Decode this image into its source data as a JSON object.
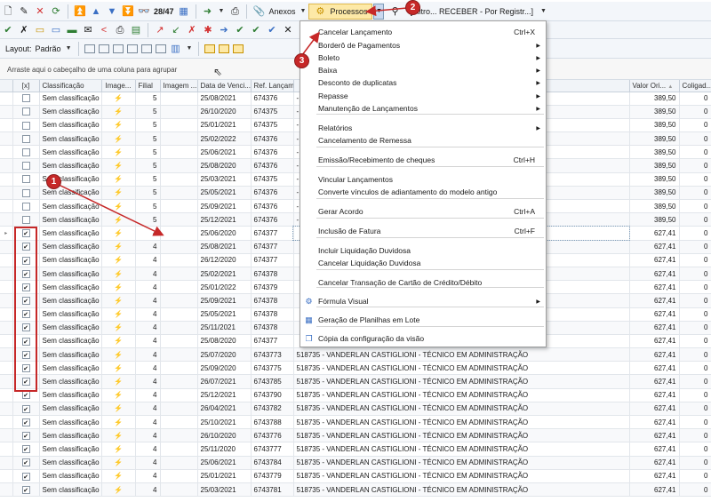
{
  "toolbar1": {
    "counter": "28/47",
    "anexos_label": "Anexos",
    "processos_label": "Processos",
    "filter_text": "[Filtro... RECEBER - Por Registr...]"
  },
  "toolbar3": {
    "layout_label": "Layout:",
    "layout_value": "Padrão"
  },
  "group_panel_text": "Arraste aqui o cabeçalho de uma coluna para agrupar",
  "columns": {
    "check": "[x]",
    "classificacao": "Classificação",
    "imagem": "Image...",
    "filial": "Filial",
    "imagem2": "Imagem ...",
    "data_venc": "Data de Venci...",
    "ref_lanc": "Ref. Lançam...",
    "valor": "Valor Ori...",
    "coligada": "Coligad..."
  },
  "rows": [
    {
      "checked": false,
      "classificacao": "Sem classificação",
      "filial": "5",
      "data": "25/08/2021",
      "ref": "674376",
      "desc": "- A DISTÂNCIA",
      "valor": "389,50",
      "col": "0"
    },
    {
      "checked": false,
      "classificacao": "Sem classificação",
      "filial": "5",
      "data": "26/10/2020",
      "ref": "674375",
      "desc": "- A DISTÂNCIA",
      "valor": "389,50",
      "col": "0"
    },
    {
      "checked": false,
      "classificacao": "Sem classificação",
      "filial": "5",
      "data": "25/01/2021",
      "ref": "674375",
      "desc": "- A DISTÂNCIA",
      "valor": "389,50",
      "col": "0"
    },
    {
      "checked": false,
      "classificacao": "Sem classificação",
      "filial": "5",
      "data": "25/02/2022",
      "ref": "674376",
      "desc": "- A DISTÂNCIA",
      "valor": "389,50",
      "col": "0"
    },
    {
      "checked": false,
      "classificacao": "Sem classificação",
      "filial": "5",
      "data": "25/06/2021",
      "ref": "674376",
      "desc": "- A DISTÂNCIA",
      "valor": "389,50",
      "col": "0"
    },
    {
      "checked": false,
      "classificacao": "Sem classificação",
      "filial": "5",
      "data": "25/08/2020",
      "ref": "674376",
      "desc": "- A DISTÂNCIA",
      "valor": "389,50",
      "col": "0"
    },
    {
      "checked": false,
      "classificacao": "Sem classificação",
      "filial": "5",
      "data": "25/03/2021",
      "ref": "674375",
      "desc": "- A DISTÂNCIA",
      "valor": "389,50",
      "col": "0"
    },
    {
      "checked": false,
      "classificacao": "Sem classificação",
      "filial": "5",
      "data": "25/05/2021",
      "ref": "674376",
      "desc": "- A DISTÂNCIA",
      "valor": "389,50",
      "col": "0"
    },
    {
      "checked": false,
      "classificacao": "Sem classificação",
      "filial": "5",
      "data": "25/09/2021",
      "ref": "674376",
      "desc": "- A DISTÂNCIA",
      "valor": "389,50",
      "col": "0"
    },
    {
      "checked": false,
      "classificacao": "Sem classificação",
      "filial": "5",
      "data": "25/12/2021",
      "ref": "674376",
      "desc": "- A DISTÂNCIA",
      "valor": "389,50",
      "col": "0"
    },
    {
      "checked": true,
      "classificacao": "Sem classificação",
      "filial": "4",
      "data": "25/06/2020",
      "ref": "674377",
      "desc": "",
      "valor": "627,41",
      "col": "0"
    },
    {
      "checked": true,
      "classificacao": "Sem classificação",
      "filial": "4",
      "data": "25/08/2021",
      "ref": "674377",
      "desc": "",
      "valor": "627,41",
      "col": "0"
    },
    {
      "checked": true,
      "classificacao": "Sem classificação",
      "filial": "4",
      "data": "26/12/2020",
      "ref": "674377",
      "desc": "",
      "valor": "627,41",
      "col": "0"
    },
    {
      "checked": true,
      "classificacao": "Sem classificação",
      "filial": "4",
      "data": "25/02/2021",
      "ref": "674378",
      "desc": "",
      "valor": "627,41",
      "col": "0"
    },
    {
      "checked": true,
      "classificacao": "Sem classificação",
      "filial": "4",
      "data": "25/01/2022",
      "ref": "674379",
      "desc": "",
      "valor": "627,41",
      "col": "0"
    },
    {
      "checked": true,
      "classificacao": "Sem classificação",
      "filial": "4",
      "data": "25/09/2021",
      "ref": "674378",
      "desc": "",
      "valor": "627,41",
      "col": "0"
    },
    {
      "checked": true,
      "classificacao": "Sem classificação",
      "filial": "4",
      "data": "25/05/2021",
      "ref": "674378",
      "desc": "",
      "valor": "627,41",
      "col": "0"
    },
    {
      "checked": true,
      "classificacao": "Sem classificação",
      "filial": "4",
      "data": "25/11/2021",
      "ref": "674378",
      "desc": "",
      "valor": "627,41",
      "col": "0"
    },
    {
      "checked": true,
      "classificacao": "Sem classificação",
      "filial": "4",
      "data": "25/08/2020",
      "ref": "674377",
      "desc": "",
      "valor": "627,41",
      "col": "0"
    },
    {
      "checked": true,
      "classificacao": "Sem classificação",
      "filial": "4",
      "data": "25/07/2020",
      "ref": "6743773",
      "desc": "518735 - VANDERLAN CASTIGLIONI - TÉCNICO EM ADMINISTRAÇÃO",
      "valor": "627,41",
      "col": "0"
    },
    {
      "checked": true,
      "classificacao": "Sem classificação",
      "filial": "4",
      "data": "25/09/2020",
      "ref": "6743775",
      "desc": "518735 - VANDERLAN CASTIGLIONI - TÉCNICO EM ADMINISTRAÇÃO",
      "valor": "627,41",
      "col": "0"
    },
    {
      "checked": true,
      "classificacao": "Sem classificação",
      "filial": "4",
      "data": "26/07/2021",
      "ref": "6743785",
      "desc": "518735 - VANDERLAN CASTIGLIONI - TÉCNICO EM ADMINISTRAÇÃO",
      "valor": "627,41",
      "col": "0"
    },
    {
      "checked": true,
      "classificacao": "Sem classificação",
      "filial": "4",
      "data": "25/12/2021",
      "ref": "6743790",
      "desc": "518735 - VANDERLAN CASTIGLIONI - TÉCNICO EM ADMINISTRAÇÃO",
      "valor": "627,41",
      "col": "0"
    },
    {
      "checked": true,
      "classificacao": "Sem classificação",
      "filial": "4",
      "data": "26/04/2021",
      "ref": "6743782",
      "desc": "518735 - VANDERLAN CASTIGLIONI - TÉCNICO EM ADMINISTRAÇÃO",
      "valor": "627,41",
      "col": "0"
    },
    {
      "checked": true,
      "classificacao": "Sem classificação",
      "filial": "4",
      "data": "25/10/2021",
      "ref": "6743788",
      "desc": "518735 - VANDERLAN CASTIGLIONI - TÉCNICO EM ADMINISTRAÇÃO",
      "valor": "627,41",
      "col": "0"
    },
    {
      "checked": true,
      "classificacao": "Sem classificação",
      "filial": "4",
      "data": "26/10/2020",
      "ref": "6743776",
      "desc": "518735 - VANDERLAN CASTIGLIONI - TÉCNICO EM ADMINISTRAÇÃO",
      "valor": "627,41",
      "col": "0"
    },
    {
      "checked": true,
      "classificacao": "Sem classificação",
      "filial": "4",
      "data": "25/11/2020",
      "ref": "6743777",
      "desc": "518735 - VANDERLAN CASTIGLIONI - TÉCNICO EM ADMINISTRAÇÃO",
      "valor": "627,41",
      "col": "0"
    },
    {
      "checked": true,
      "classificacao": "Sem classificação",
      "filial": "4",
      "data": "25/06/2021",
      "ref": "6743784",
      "desc": "518735 - VANDERLAN CASTIGLIONI - TÉCNICO EM ADMINISTRAÇÃO",
      "valor": "627,41",
      "col": "0"
    },
    {
      "checked": true,
      "classificacao": "Sem classificação",
      "filial": "4",
      "data": "25/01/2021",
      "ref": "6743779",
      "desc": "518735 - VANDERLAN CASTIGLIONI - TÉCNICO EM ADMINISTRAÇÃO",
      "valor": "627,41",
      "col": "0"
    },
    {
      "checked": true,
      "classificacao": "Sem classificação",
      "filial": "4",
      "data": "25/03/2021",
      "ref": "6743781",
      "desc": "518735 - VANDERLAN CASTIGLIONI - TÉCNICO EM ADMINISTRAÇÃO",
      "valor": "627,41",
      "col": "0"
    }
  ],
  "menu": {
    "items": [
      {
        "label": "Cancelar Lançamento",
        "shortcut": "Ctrl+X",
        "submenu": false
      },
      {
        "label": "Borderô de Pagamentos",
        "shortcut": "",
        "submenu": true
      },
      {
        "label": "Boleto",
        "shortcut": "",
        "submenu": true
      },
      {
        "label": "Baixa",
        "shortcut": "",
        "submenu": true
      },
      {
        "label": "Desconto de duplicatas",
        "shortcut": "",
        "submenu": true
      },
      {
        "label": "Repasse",
        "shortcut": "",
        "submenu": true
      },
      {
        "label": "Manutenção de Lançamentos",
        "shortcut": "",
        "submenu": true
      },
      {
        "label": "Relatórios",
        "shortcut": "",
        "submenu": true
      },
      {
        "label": "Cancelamento de Remessa",
        "shortcut": "",
        "submenu": false
      },
      {
        "label": "Emissão/Recebimento de cheques",
        "shortcut": "Ctrl+H",
        "submenu": false
      },
      {
        "label": "Vincular Lançamentos",
        "shortcut": "",
        "submenu": false
      },
      {
        "label": "Converte vínculos de adiantamento do modelo antigo",
        "shortcut": "",
        "submenu": false
      },
      {
        "label": "Gerar Acordo",
        "shortcut": "Ctrl+A",
        "submenu": false
      },
      {
        "label": "Inclusão de Fatura",
        "shortcut": "Ctrl+F",
        "submenu": false
      },
      {
        "label": "Incluir Liquidação Duvidosa",
        "shortcut": "",
        "submenu": false
      },
      {
        "label": "Cancelar Liquidação Duvidosa",
        "shortcut": "",
        "submenu": false
      },
      {
        "label": "Cancelar Transação de Cartão de Crédito/Débito",
        "shortcut": "",
        "submenu": false
      },
      {
        "label": "Fórmula Visual",
        "shortcut": "",
        "submenu": true
      },
      {
        "label": "Geração de Planilhas em Lote",
        "shortcut": "",
        "submenu": false
      },
      {
        "label": "Cópia da configuração da visão",
        "shortcut": "",
        "submenu": false
      }
    ]
  },
  "annotations": {
    "badge1": "1",
    "badge2": "2",
    "badge3": "3",
    "color": "#c62828"
  },
  "icons": {
    "check_mark": "✔",
    "img_icon": "⚡"
  }
}
